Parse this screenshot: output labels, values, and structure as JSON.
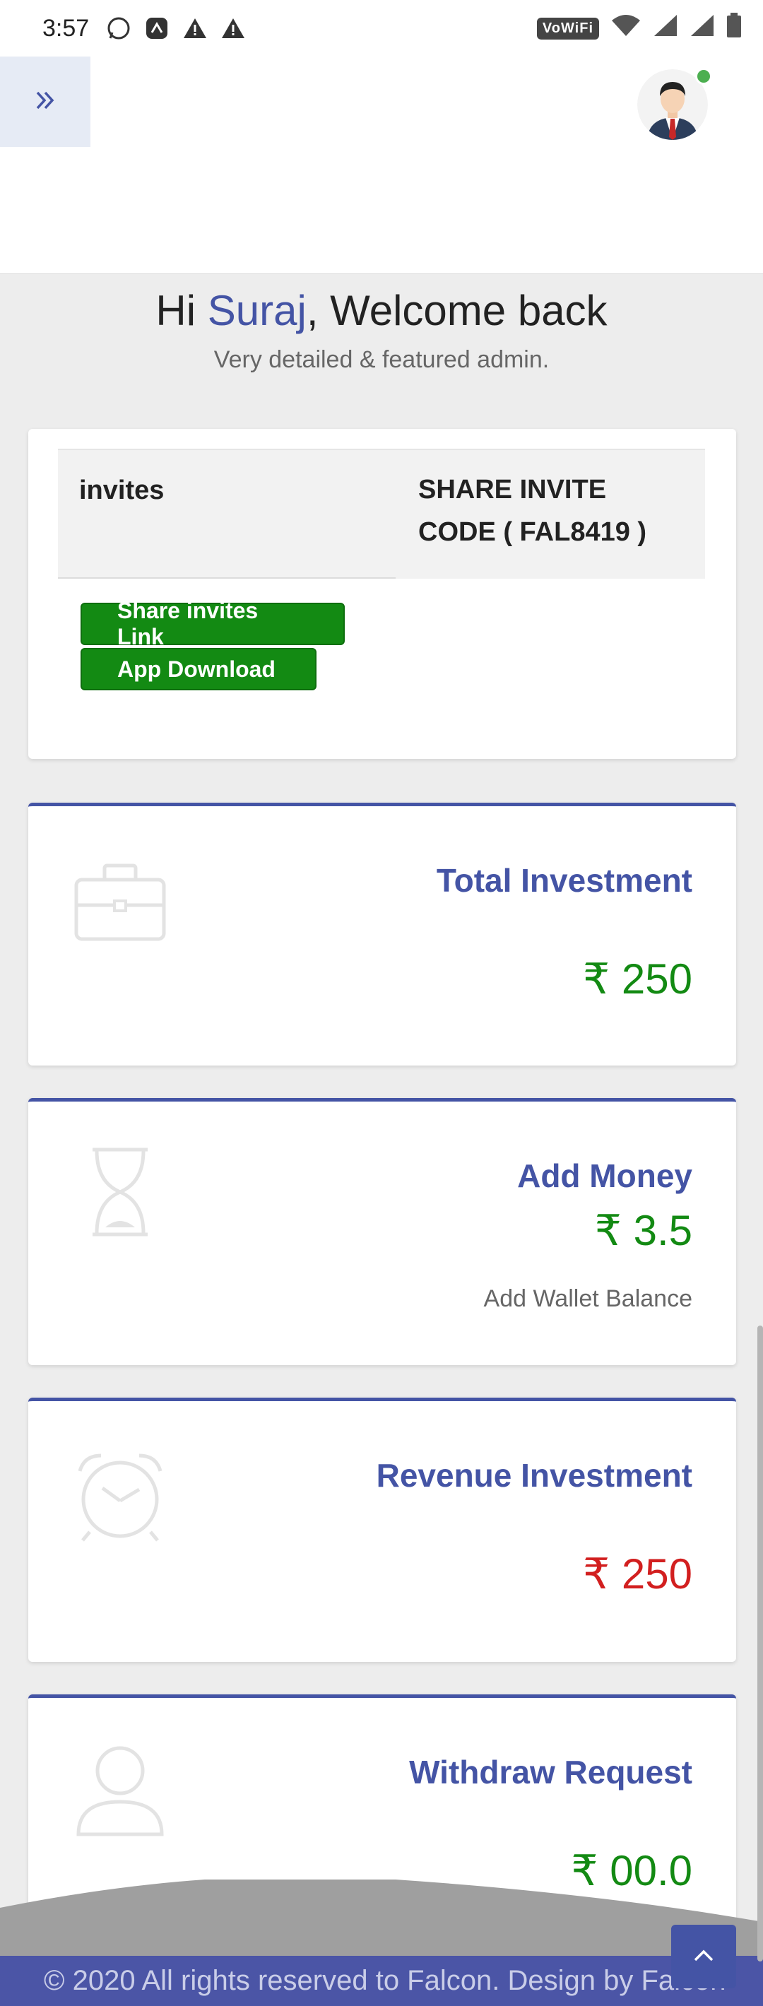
{
  "status_bar": {
    "time": "3:57",
    "network_label": "VoWiFi",
    "icons": [
      "whatsapp-icon",
      "app-notification-icon",
      "warning-icon",
      "warning-icon",
      "wifi-icon",
      "signal-icon",
      "battery-icon"
    ]
  },
  "welcome": {
    "greeting_prefix": "Hi ",
    "user_name": "Suraj",
    "greeting_suffix": ", Welcome back",
    "subtitle": "Very detailed & featured admin."
  },
  "invites": {
    "label": "invites",
    "share_code_text": "SHARE INVITE CODE ( FAL8419 )",
    "share_link_button": "Share invites Link",
    "app_download_button": "App Download"
  },
  "stats": {
    "total_investment": {
      "title": "Total Investment",
      "value": "₹ 250",
      "icon": "briefcase-icon"
    },
    "add_money": {
      "title": "Add Money",
      "value": "₹ 3.5",
      "sub": "Add Wallet Balance",
      "icon": "hourglass-icon"
    },
    "revenue_investment": {
      "title": "Revenue Investment",
      "value": "₹ 250",
      "icon": "alarm-clock-icon"
    },
    "withdraw_request": {
      "title": "Withdraw Request",
      "value": "₹ 00.0",
      "icon": "user-icon"
    }
  },
  "footer": {
    "text": "© 2020 All rights reserved to Falcon. Design by Falcon"
  },
  "colors": {
    "accent": "#4454a5",
    "positive": "#138a13",
    "negative": "#d21f1f",
    "background": "#ededed"
  }
}
